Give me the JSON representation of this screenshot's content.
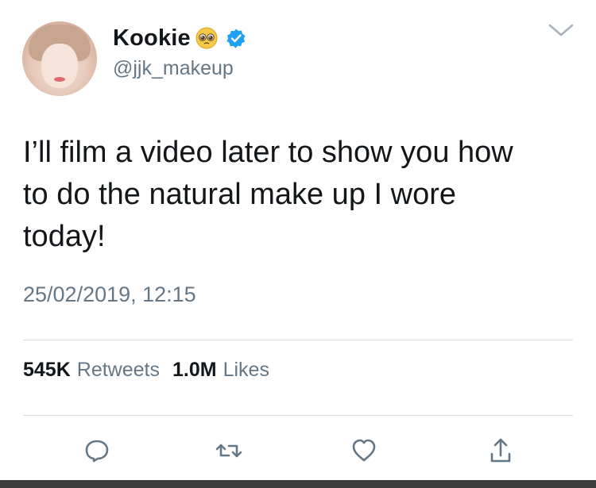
{
  "author": {
    "display_name": "Kookie",
    "handle": "@jjk_makeup",
    "emoji": "pleading-face-emoji",
    "verified_icon": "verified-badge-icon"
  },
  "tweet": {
    "text": "I’ll film a video later to show you how\nto do the natural make up I wore\ntoday!",
    "timestamp": "25/02/2019, 12:15"
  },
  "stats": {
    "retweets_count": "545K",
    "retweets_label": "Retweets",
    "likes_count": "1.0M",
    "likes_label": "Likes"
  },
  "actions": [
    "reply-icon",
    "retweet-icon",
    "like-icon",
    "share-icon"
  ],
  "colors": {
    "text": "#14171a",
    "muted": "#657786",
    "verified": "#1da1f2",
    "divider": "#d8dde1"
  }
}
